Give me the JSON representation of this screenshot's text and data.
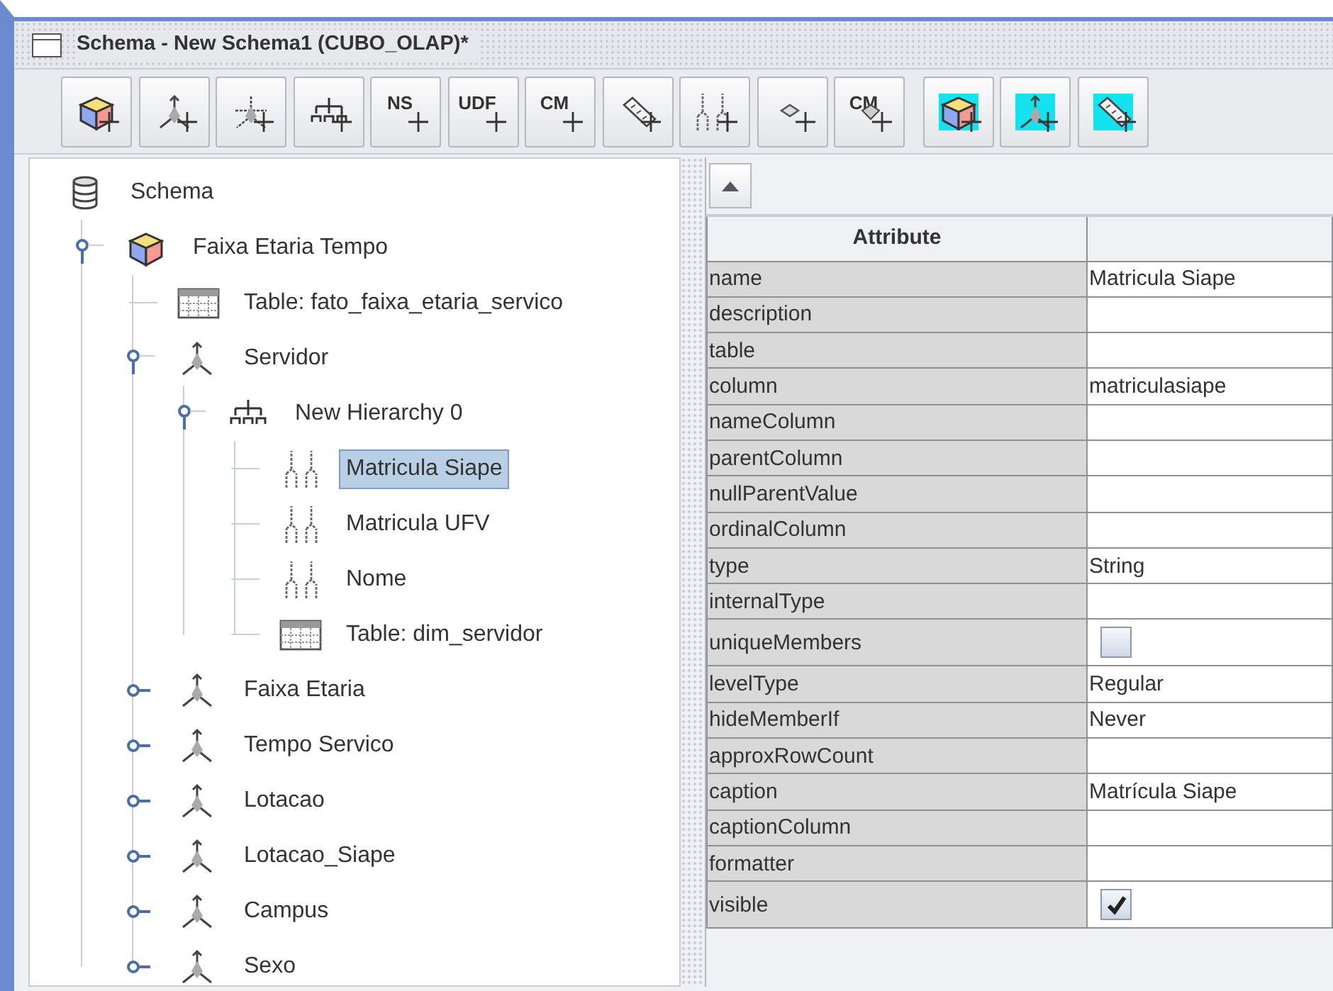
{
  "window": {
    "title": "Schema - New Schema1 (CUBO_OLAP)*"
  },
  "toolbar": {
    "buttons": [
      {
        "kind": "cube",
        "highlighted": false
      },
      {
        "kind": "dimension",
        "highlighted": false
      },
      {
        "kind": "dimension-usage",
        "highlighted": false
      },
      {
        "kind": "hierarchy",
        "highlighted": false
      },
      {
        "kind": "text",
        "label": "NS",
        "highlighted": false
      },
      {
        "kind": "text",
        "label": "UDF",
        "highlighted": false
      },
      {
        "kind": "text",
        "label": "CM",
        "highlighted": false
      },
      {
        "kind": "measure",
        "highlighted": false
      },
      {
        "kind": "level",
        "highlighted": false
      },
      {
        "kind": "property",
        "highlighted": false
      },
      {
        "kind": "text-gem",
        "label": "CM",
        "highlighted": false
      },
      {
        "kind": "cube",
        "highlighted": true
      },
      {
        "kind": "dimension",
        "highlighted": true
      },
      {
        "kind": "measure",
        "highlighted": true
      }
    ]
  },
  "tree": {
    "kind": "schema",
    "label": "Schema",
    "selected": false,
    "children": [
      {
        "kind": "cube",
        "label": "Faixa Etaria Tempo",
        "expanded": true,
        "selected": false,
        "children": [
          {
            "kind": "table",
            "label": "Table: fato_faixa_etaria_servico",
            "selected": false
          },
          {
            "kind": "dimension",
            "label": "Servidor",
            "expanded": true,
            "selected": false,
            "children": [
              {
                "kind": "hierarchy",
                "label": "New Hierarchy 0",
                "expanded": true,
                "selected": false,
                "children": [
                  {
                    "kind": "level",
                    "label": "Matricula Siape",
                    "selected": true
                  },
                  {
                    "kind": "level",
                    "label": "Matricula UFV",
                    "selected": false
                  },
                  {
                    "kind": "level",
                    "label": "Nome",
                    "selected": false
                  },
                  {
                    "kind": "table",
                    "label": "Table: dim_servidor",
                    "selected": false
                  }
                ]
              }
            ]
          },
          {
            "kind": "dimension",
            "label": "Faixa Etaria",
            "expanded": false,
            "selected": false
          },
          {
            "kind": "dimension",
            "label": "Tempo Servico",
            "expanded": false,
            "selected": false
          },
          {
            "kind": "dimension",
            "label": "Lotacao",
            "expanded": false,
            "selected": false
          },
          {
            "kind": "dimension",
            "label": "Lotacao_Siape",
            "expanded": false,
            "selected": false
          },
          {
            "kind": "dimension",
            "label": "Campus",
            "expanded": false,
            "selected": false
          },
          {
            "kind": "dimension",
            "label": "Sexo",
            "expanded": false,
            "selected": false
          }
        ]
      }
    ]
  },
  "properties": {
    "columns": [
      "Attribute"
    ],
    "rows": [
      {
        "attribute": "name",
        "kind": "text",
        "value": "Matricula Siape"
      },
      {
        "attribute": "description",
        "kind": "text"
      },
      {
        "attribute": "table",
        "kind": "text"
      },
      {
        "attribute": "column",
        "kind": "text",
        "value": "matriculasiape"
      },
      {
        "attribute": "nameColumn",
        "kind": "text"
      },
      {
        "attribute": "parentColumn",
        "kind": "text"
      },
      {
        "attribute": "nullParentValue",
        "kind": "text"
      },
      {
        "attribute": "ordinalColumn",
        "kind": "text"
      },
      {
        "attribute": "type",
        "kind": "text",
        "value": "String"
      },
      {
        "attribute": "internalType",
        "kind": "text"
      },
      {
        "attribute": "uniqueMembers",
        "kind": "checkbox",
        "checked": false
      },
      {
        "attribute": "levelType",
        "kind": "text",
        "value": "Regular"
      },
      {
        "attribute": "hideMemberIf",
        "kind": "text",
        "value": "Never"
      },
      {
        "attribute": "approxRowCount",
        "kind": "text"
      },
      {
        "attribute": "caption",
        "kind": "text",
        "value": "Matrícula Siape"
      },
      {
        "attribute": "captionColumn",
        "kind": "text"
      },
      {
        "attribute": "formatter",
        "kind": "text"
      },
      {
        "attribute": "visible",
        "kind": "checkbox",
        "checked": true
      }
    ]
  }
}
